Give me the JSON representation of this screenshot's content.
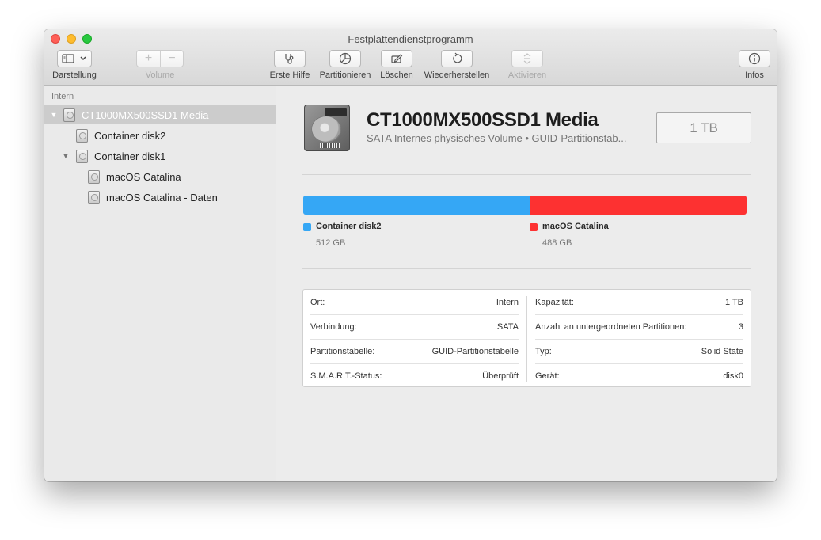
{
  "window": {
    "title": "Festplattendienstprogramm"
  },
  "toolbar": {
    "view": {
      "label": "Darstellung",
      "icon": "sidebar-icon"
    },
    "volume": {
      "label": "Volume",
      "add": "+",
      "remove": "−"
    },
    "first_aid": {
      "label": "Erste Hilfe",
      "icon": "stethoscope-icon"
    },
    "partition": {
      "label": "Partitionieren",
      "icon": "pie-icon"
    },
    "erase": {
      "label": "Löschen",
      "icon": "erase-icon"
    },
    "restore": {
      "label": "Wiederherstellen",
      "icon": "restore-icon"
    },
    "mount": {
      "label": "Aktivieren",
      "icon": "mount-icon"
    },
    "info": {
      "label": "Infos",
      "icon": "info-icon"
    }
  },
  "sidebar": {
    "section": "Intern",
    "items": [
      {
        "label": "CT1000MX500SSD1 Media"
      },
      {
        "label": "Container disk2"
      },
      {
        "label": "Container disk1"
      },
      {
        "label": "macOS Catalina"
      },
      {
        "label": "macOS Catalina - Daten"
      }
    ]
  },
  "detail": {
    "name": "CT1000MX500SSD1 Media",
    "subtitle": "SATA Internes physisches Volume • GUID-Partitionstab...",
    "size": "1 TB",
    "usage": [
      {
        "name": "Container disk2",
        "size": "512 GB",
        "fraction": 0.512,
        "color": "#35a7f5"
      },
      {
        "name": "macOS Catalina",
        "size": "488 GB",
        "fraction": 0.488,
        "color": "#fd3131"
      }
    ],
    "info_left": [
      {
        "key": "Ort:",
        "value": "Intern"
      },
      {
        "key": "Verbindung:",
        "value": "SATA"
      },
      {
        "key": "Partitionstabelle:",
        "value": "GUID-Partitionstabelle"
      },
      {
        "key": "S.M.A.R.T.-Status:",
        "value": "Überprüft"
      }
    ],
    "info_right": [
      {
        "key": "Kapazität:",
        "value": "1 TB"
      },
      {
        "key": "Anzahl an untergeordneten Partitionen:",
        "value": "3"
      },
      {
        "key": "Typ:",
        "value": "Solid State"
      },
      {
        "key": "Gerät:",
        "value": "disk0"
      }
    ]
  }
}
